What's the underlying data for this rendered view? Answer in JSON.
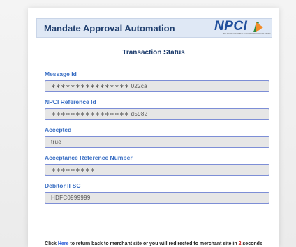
{
  "header": {
    "title": "Mandate Approval Automation",
    "logo_text": "NPCI",
    "logo_tagline": "NATIONAL PAYMENTS CORPORATION OF INDIA"
  },
  "page_title": "Transaction Status",
  "fields": [
    {
      "label": "Message Id",
      "value": "∗∗∗∗∗∗∗∗∗∗∗∗∗∗∗∗ 022ca"
    },
    {
      "label": "NPCI Reference Id",
      "value": "∗∗∗∗∗∗∗∗∗∗∗∗∗∗∗∗ d5982"
    },
    {
      "label": "Accepted",
      "value": "true"
    },
    {
      "label": "Acceptance Reference Number",
      "value": "∗∗∗∗∗∗∗∗∗"
    },
    {
      "label": "Debitor IFSC",
      "value": "HDFC0999999"
    }
  ],
  "footer": {
    "prefix": "Click ",
    "link": "Here",
    "middle": " to return back to merchant site or you will redirected to merchant site in ",
    "countdown": "2",
    "suffix": " seconds"
  },
  "colors": {
    "title": "#1f3e6e",
    "label": "#3a6fc4",
    "link": "#2a5bd7",
    "countdown": "#d21f1f"
  }
}
